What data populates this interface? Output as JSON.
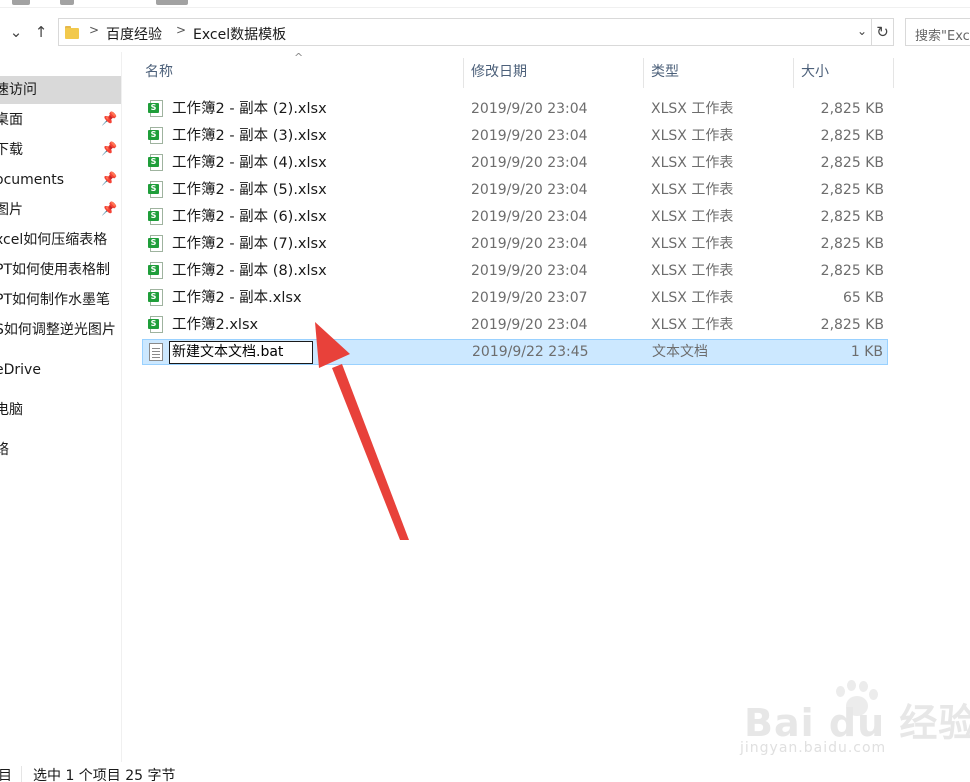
{
  "address": {
    "crumbs": [
      "百度经验",
      "Excel数据模板"
    ],
    "separator": ">"
  },
  "search": {
    "placeholder": "搜索\"Exc"
  },
  "sidebar": {
    "items": [
      {
        "label": "速访问",
        "pinned": false,
        "selected": true
      },
      {
        "label": "桌面",
        "pinned": true
      },
      {
        "label": "下载",
        "pinned": true
      },
      {
        "label": "ocuments",
        "pinned": true
      },
      {
        "label": "图片",
        "pinned": true
      },
      {
        "label": "xcel如何压缩表格",
        "pinned": false
      },
      {
        "label": "PT如何使用表格制",
        "pinned": false
      },
      {
        "label": "PT如何制作水墨笔",
        "pinned": false
      },
      {
        "label": "S如何调整逆光图片",
        "pinned": false
      },
      {
        "label": "eDrive",
        "pinned": false
      },
      {
        "label": "电脑",
        "pinned": false
      },
      {
        "label": "络",
        "pinned": false
      }
    ]
  },
  "columns": {
    "name": "名称",
    "date": "修改日期",
    "type": "类型",
    "size": "大小"
  },
  "files": [
    {
      "name": "工作簿2 - 副本 (2).xlsx",
      "date": "2019/9/20 23:04",
      "type": "XLSX 工作表",
      "size": "2,825 KB",
      "icon": "excel-file-icon"
    },
    {
      "name": "工作簿2 - 副本 (3).xlsx",
      "date": "2019/9/20 23:04",
      "type": "XLSX 工作表",
      "size": "2,825 KB",
      "icon": "excel-file-icon"
    },
    {
      "name": "工作簿2 - 副本 (4).xlsx",
      "date": "2019/9/20 23:04",
      "type": "XLSX 工作表",
      "size": "2,825 KB",
      "icon": "excel-file-icon"
    },
    {
      "name": "工作簿2 - 副本 (5).xlsx",
      "date": "2019/9/20 23:04",
      "type": "XLSX 工作表",
      "size": "2,825 KB",
      "icon": "excel-file-icon"
    },
    {
      "name": "工作簿2 - 副本 (6).xlsx",
      "date": "2019/9/20 23:04",
      "type": "XLSX 工作表",
      "size": "2,825 KB",
      "icon": "excel-file-icon"
    },
    {
      "name": "工作簿2 - 副本 (7).xlsx",
      "date": "2019/9/20 23:04",
      "type": "XLSX 工作表",
      "size": "2,825 KB",
      "icon": "excel-file-icon"
    },
    {
      "name": "工作簿2 - 副本 (8).xlsx",
      "date": "2019/9/20 23:04",
      "type": "XLSX 工作表",
      "size": "2,825 KB",
      "icon": "excel-file-icon"
    },
    {
      "name": "工作簿2 - 副本.xlsx",
      "date": "2019/9/20 23:07",
      "type": "XLSX 工作表",
      "size": "65 KB",
      "icon": "excel-file-icon"
    },
    {
      "name": "工作簿2.xlsx",
      "date": "2019/9/20 23:04",
      "type": "XLSX 工作表",
      "size": "2,825 KB",
      "icon": "excel-file-icon"
    },
    {
      "name": "新建文本文档.bat",
      "date": "2019/9/22 23:45",
      "type": "文本文档",
      "size": "1 KB",
      "icon": "text-file-icon",
      "selected": true,
      "renaming": true
    }
  ],
  "status": {
    "count": "目",
    "selection": "选中 1 个项目  25 字节"
  },
  "watermark": {
    "main": "Bai du 经验",
    "sub": "jingyan.baidu.com"
  },
  "colors": {
    "selection_bg": "#cce8ff",
    "selection_border": "#99d1ff",
    "arrow": "#e8413a",
    "header_text": "#4c607a"
  }
}
